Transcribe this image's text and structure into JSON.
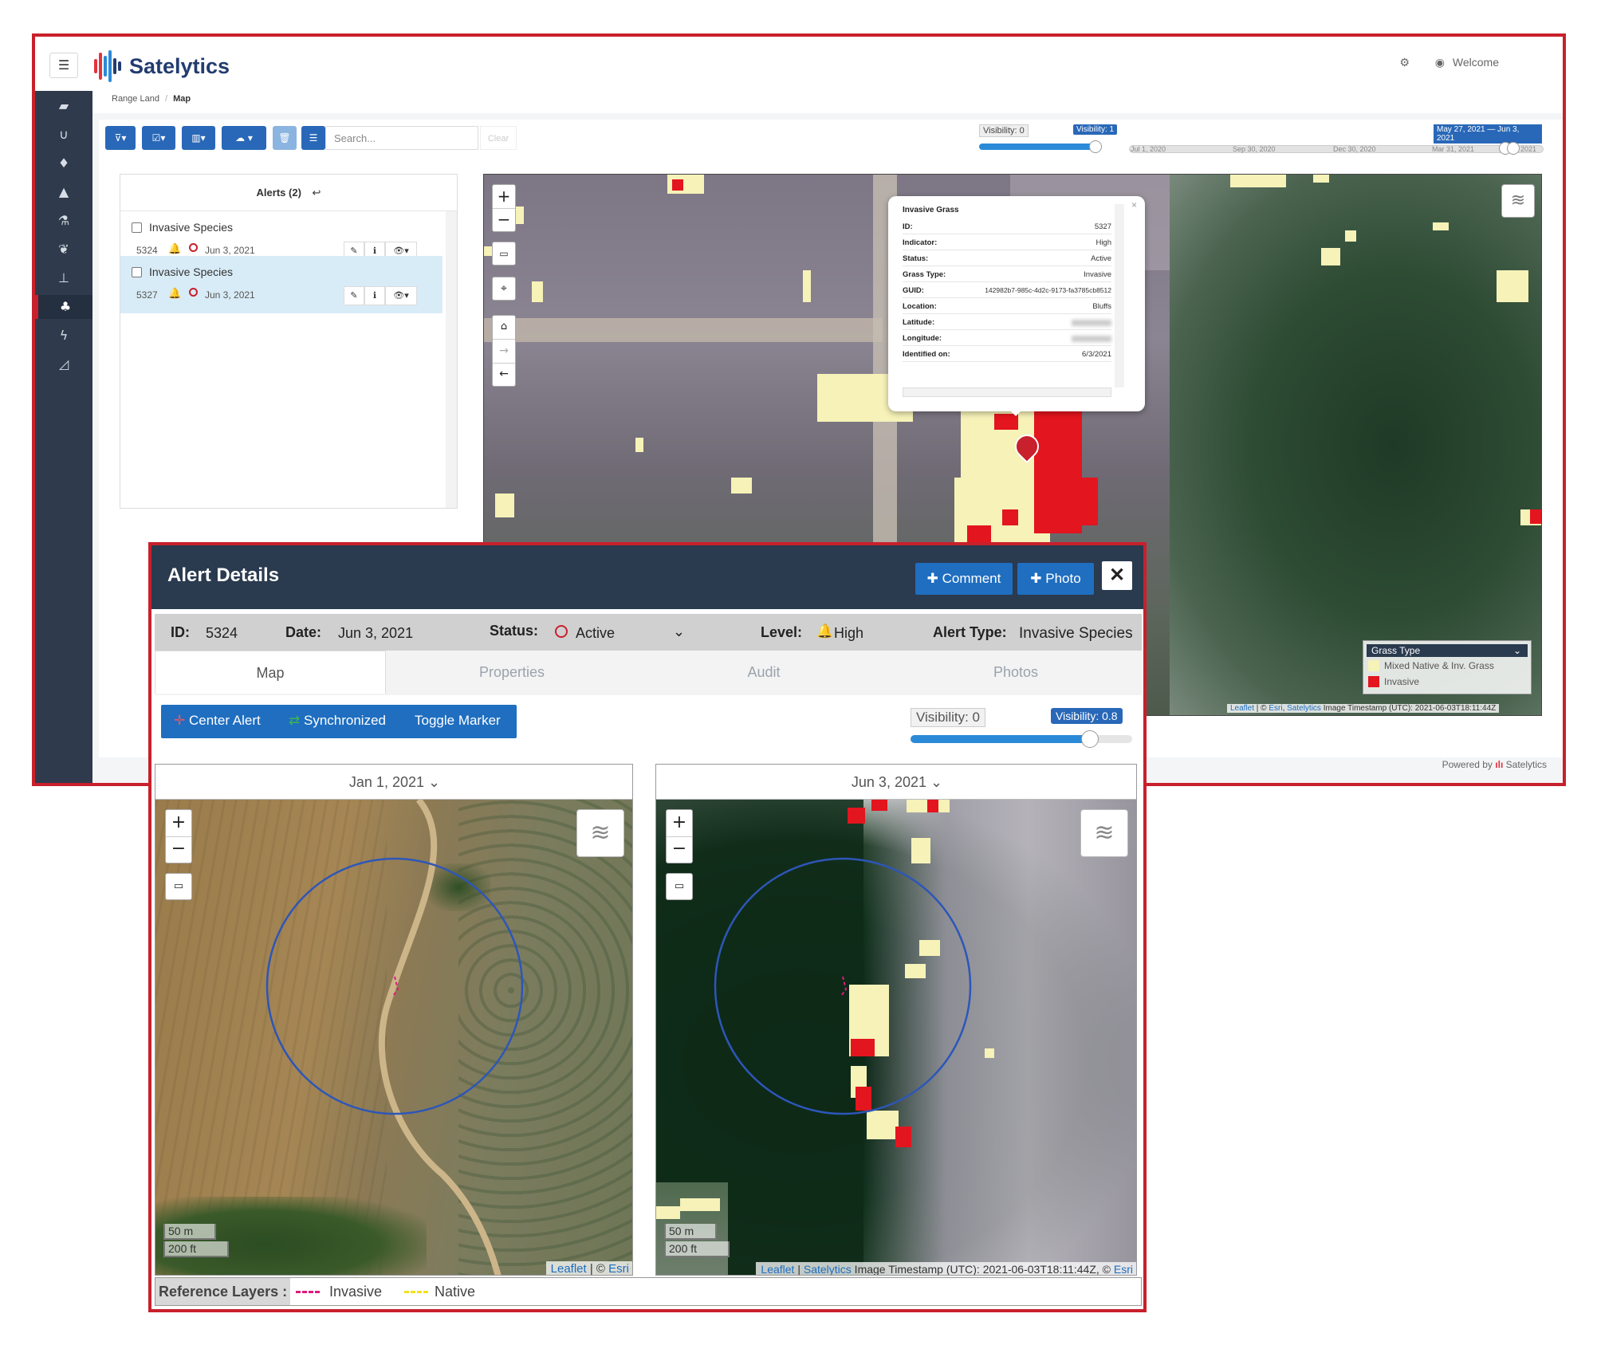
{
  "app": {
    "name": "Satelytics",
    "welcome": "Welcome",
    "powered_by": "Powered by",
    "powered_brand": "Satelytics"
  },
  "breadcrumb": {
    "parent": "Range Land",
    "separator": "/",
    "current": "Map"
  },
  "toolbar": {
    "search_placeholder": "Search...",
    "clear_label": "Clear"
  },
  "timeline": {
    "visibility_min": "Visibility: 0",
    "visibility_max": "Visibility: 1",
    "range_label": "May 27, 2021 — Jun 3, 2021",
    "ticks": [
      "Jul 1, 2020",
      "Sep 30, 2020",
      "Dec 30, 2020",
      "Mar 31, 2021",
      "30, 2021"
    ],
    "visibility_value": 1
  },
  "alerts": {
    "title": "Alerts (2)",
    "items": [
      {
        "type": "Invasive Species",
        "id": "5324",
        "date": "Jun 3, 2021",
        "selected": false
      },
      {
        "type": "Invasive Species",
        "id": "5327",
        "date": "Jun 3, 2021",
        "selected": true
      }
    ]
  },
  "popup": {
    "title": "Invasive Grass",
    "rows": [
      {
        "k": "ID:",
        "v": "5327"
      },
      {
        "k": "Indicator:",
        "v": "High"
      },
      {
        "k": "Status:",
        "v": "Active"
      },
      {
        "k": "Grass Type:",
        "v": "Invasive"
      },
      {
        "k": "GUID:",
        "v": "142982b7-985c-4d2c-9173-fa3785cb8512"
      },
      {
        "k": "Location:",
        "v": "Bluffs"
      },
      {
        "k": "Latitude:",
        "v": ""
      },
      {
        "k": "Longitude:",
        "v": ""
      },
      {
        "k": "Identified on:",
        "v": "6/3/2021"
      }
    ]
  },
  "main_map": {
    "legend_title": "Grass Type",
    "legend_items": [
      {
        "label": "Mixed Native & Inv. Grass",
        "color": "#f6f2b8"
      },
      {
        "label": "Invasive",
        "color": "#e3151f"
      }
    ],
    "attribution_leaflet": "Leaflet",
    "attribution_sep": " | © ",
    "attribution_esri": "Esri",
    "attribution_satelytics": "Satelytics",
    "attribution_timestamp": "Image Timestamp (UTC): 2021-06-03T18:11:44Z"
  },
  "detail": {
    "title": "Alert Details",
    "comment_btn": "Comment",
    "photo_btn": "Photo",
    "close": "✕",
    "id_label": "ID:",
    "id_value": "5324",
    "date_label": "Date:",
    "date_value": "Jun 3, 2021",
    "status_label": "Status:",
    "status_value": "Active",
    "level_label": "Level:",
    "level_value": "High",
    "type_label": "Alert Type:",
    "type_value": "Invasive Species",
    "tabs": [
      "Map",
      "Properties",
      "Audit",
      "Photos"
    ],
    "center_alert": "Center Alert",
    "synchronized": "Synchronized",
    "toggle_marker": "Toggle Marker",
    "visibility_min": "Visibility: 0",
    "visibility_max": "Visibility: 0.8",
    "visibility_value": 0.8,
    "left_map_date": "Jan 1, 2021",
    "right_map_date": "Jun 3, 2021",
    "scale_m": "50 m",
    "scale_ft": "200 ft",
    "left_attr_leaflet": "Leaflet",
    "left_attr_rest": " | © ",
    "left_attr_esri": "Esri",
    "right_attr_leaflet": "Leaflet",
    "right_attr_satelytics": "Satelytics",
    "right_attr_timestamp": " Image Timestamp (UTC): 2021-06-03T18:11:44Z, © ",
    "right_attr_esri": "Esri",
    "ref_layers_label": "Reference Layers :",
    "ref_invasive": "Invasive",
    "ref_native": "Native",
    "invasive_color": "#e0197d",
    "native_color": "#f2e21b"
  },
  "colors": {
    "brand_red": "#c8202c",
    "primary_blue": "#2968b8",
    "sidebar": "#2f3b4c",
    "modal_header": "#2a3a4f"
  }
}
